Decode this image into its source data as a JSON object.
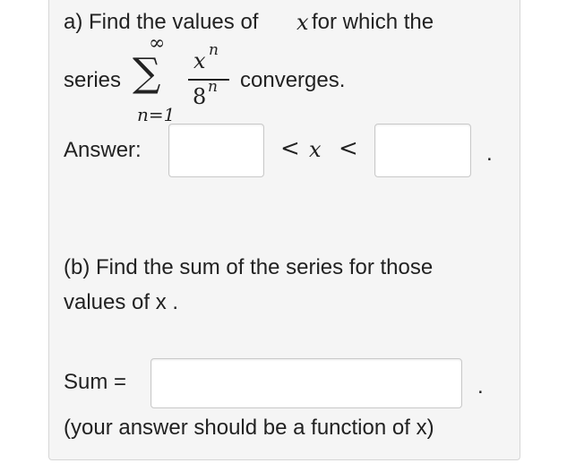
{
  "part_a": {
    "line1_prefix": "a) Find the values of ",
    "line1_var": "x",
    "line1_suffix": " for which the",
    "series_label": "series",
    "sum_symbol": "∑",
    "sum_upper": "∞",
    "sum_lower": "n=1",
    "numerator": "x",
    "numerator_exp": "n",
    "denominator": "8",
    "denominator_exp": "n",
    "converges_label": "converges.",
    "answer_label": "Answer:",
    "lt_1": "<",
    "var_x": "x",
    "lt_2": "<",
    "lower_bound_value": "",
    "upper_bound_value": "",
    "period": "."
  },
  "part_b": {
    "line1": "(b) Find the sum of the series for those",
    "line2": "values of x .",
    "sum_label": "Sum =",
    "sum_value": "",
    "period": ".",
    "hint": "(your answer should be a function of x)"
  }
}
